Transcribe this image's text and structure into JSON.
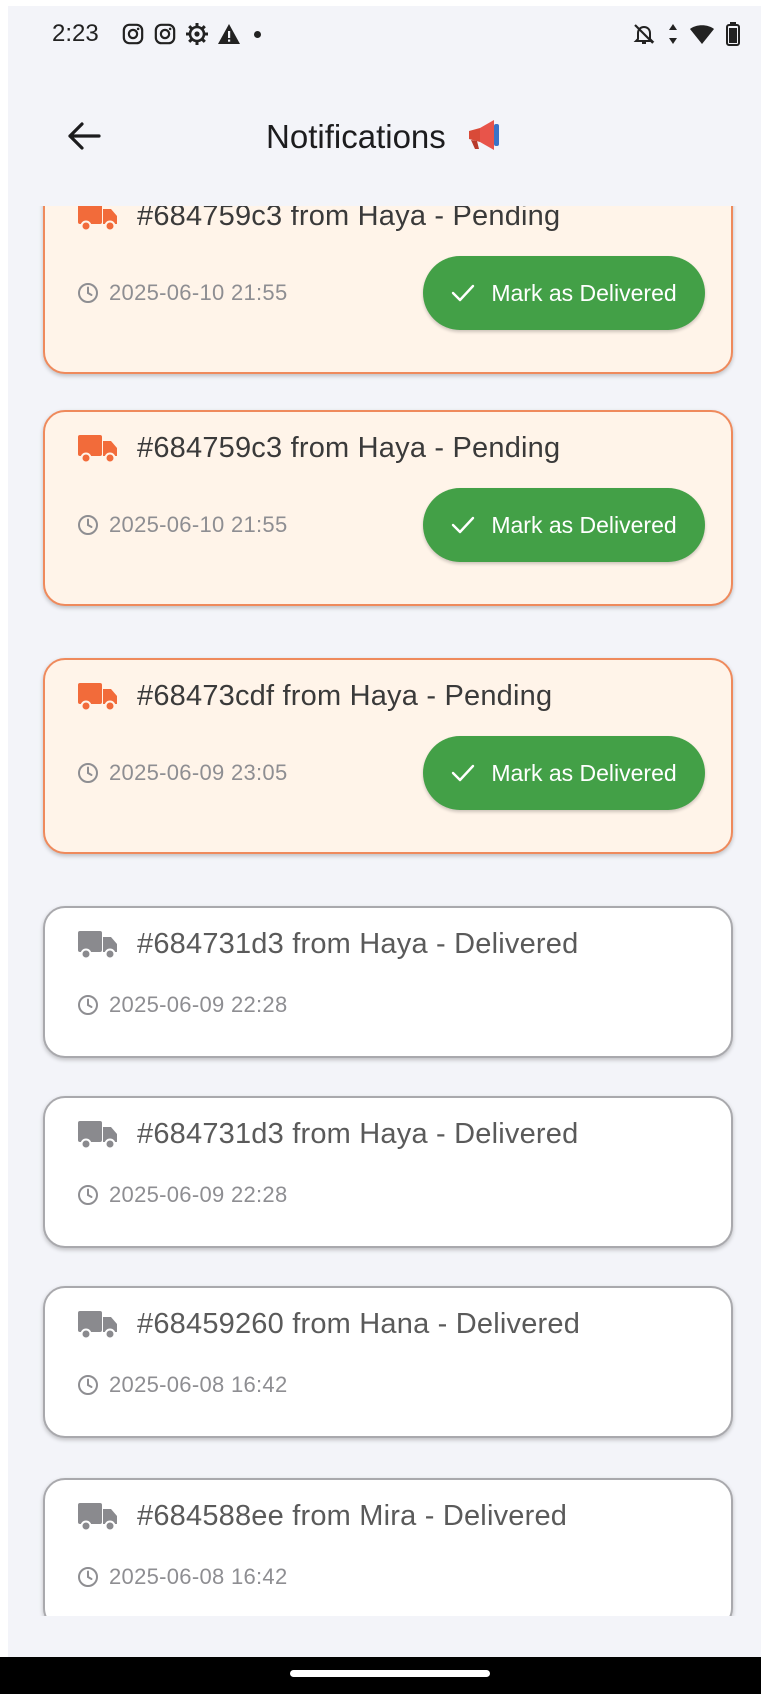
{
  "status_bar": {
    "time": "2:23",
    "left_icons": [
      "instagram-icon",
      "instagram-icon",
      "settings-gear-icon",
      "warning-icon",
      "dot-icon"
    ],
    "right_icons": [
      "notifications-off-icon",
      "data-arrows-icon",
      "wifi-icon",
      "battery-icon"
    ]
  },
  "app_bar": {
    "title": "Notifications",
    "title_icon": "megaphone-icon",
    "back_icon": "arrow-left-icon"
  },
  "colors": {
    "pending_bg": "#fff4e9",
    "pending_border": "#ef8a5c",
    "pending_truck": "#f26b3a",
    "delivered_truck": "#8a8a8e",
    "button_green": "#43a047"
  },
  "notifications": [
    {
      "title": "#684759c3 from Haya - Pending",
      "time": "2025-06-10 21:55",
      "status": "pending",
      "action": "Mark as Delivered"
    },
    {
      "title": "#684759c3 from Haya - Pending",
      "time": "2025-06-10 21:55",
      "status": "pending",
      "action": "Mark as Delivered"
    },
    {
      "title": "#68473cdf from Haya - Pending",
      "time": "2025-06-09 23:05",
      "status": "pending",
      "action": "Mark as Delivered"
    },
    {
      "title": "#684731d3 from Haya - Delivered",
      "time": "2025-06-09 22:28",
      "status": "delivered"
    },
    {
      "title": "#684731d3 from Haya - Delivered",
      "time": "2025-06-09 22:28",
      "status": "delivered"
    },
    {
      "title": "#68459260 from Hana - Delivered",
      "time": "2025-06-08 16:42",
      "status": "delivered"
    },
    {
      "title": "#684588ee from Mira - Delivered",
      "time": "2025-06-08 16:42",
      "status": "delivered"
    }
  ]
}
